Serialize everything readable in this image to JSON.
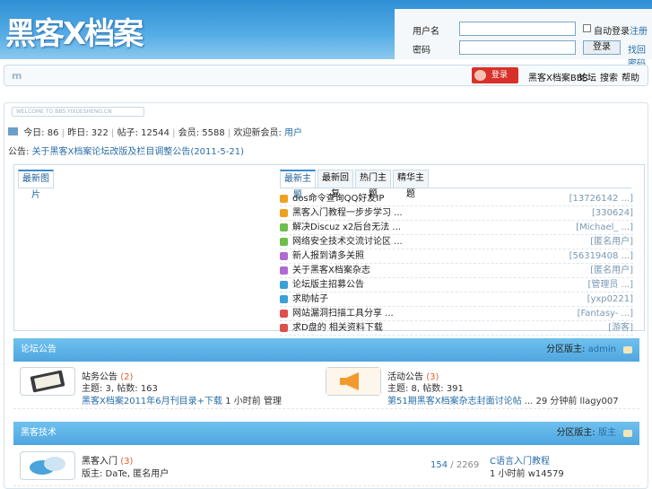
{
  "header": {
    "logo_text": "黑客X档案",
    "login": {
      "username_label": "用户名",
      "password_label": "密码",
      "remember_label": "自动登录",
      "register_link": "注册",
      "login_button": "登录",
      "forgot_link": "找回密码"
    }
  },
  "nav": {
    "logo": "m",
    "register_button": "登录",
    "items": [
      "黑客X档案BBS",
      "论坛",
      "搜索",
      "帮助"
    ]
  },
  "welcome": "WELCOME TO BBS.YIXUESHENG.CN",
  "stats": {
    "today_label": "今日:",
    "today": "86",
    "yesterday_label": "昨日:",
    "yesterday": "322",
    "posts_label": "帖子:",
    "posts": "12544",
    "members_label": "会员:",
    "members": "5588",
    "newest_label": "欢迎新会员:",
    "newest": "用户"
  },
  "notice": {
    "label": "公告:",
    "text": "关于黑客X档案论坛改版及栏目调整公告",
    "date": "(2011-5-21)"
  },
  "panel": {
    "left_tab": "最新图片",
    "tabs": [
      "最新主题",
      "最新回复",
      "热门主题",
      "精华主题"
    ],
    "topics": [
      {
        "title": "dos命令查询QQ好友IP",
        "user": "[13726142 ...]",
        "color": "#f0a020"
      },
      {
        "title": "黑客入门教程一步步学习 ...",
        "user": "[330624]",
        "color": "#f0a020"
      },
      {
        "title": "解决Discuz x2后台无法 ...",
        "user": "[Michael_ ...]",
        "color": "#6cbf4a"
      },
      {
        "title": "网络安全技术交流讨论区 ...",
        "user": "[匿名用户]",
        "color": "#6cbf4a"
      },
      {
        "title": "新人报到请多关照",
        "user": "[56319408 ...]",
        "color": "#b06ad0"
      },
      {
        "title": "关于黑客X档案杂志",
        "user": "[匿名用户]",
        "color": "#b06ad0"
      },
      {
        "title": "论坛版主招募公告",
        "user": "[管理员 ...]",
        "color": "#3aa0d8"
      },
      {
        "title": "求助帖子",
        "user": "[yxp0221]",
        "color": "#3aa0d8"
      },
      {
        "title": "网站漏洞扫描工具分享 ...",
        "user": "[Fantasy- ...]",
        "color": "#e0504a"
      },
      {
        "title": "求D盘的 相关资料下载",
        "user": "[游客]",
        "color": "#e0504a"
      }
    ]
  },
  "section1": {
    "title": "论坛公告",
    "mod_label": "分区版主:",
    "mod": "admin",
    "forums": [
      {
        "name": "站务公告",
        "count": "(2)",
        "stats": "主题: 3, 帖数: 163",
        "last": "黑客X档案2011年6月刊目录+下载",
        "last_meta": "1 小时前 管理"
      },
      {
        "name": "活动公告",
        "count": "(3)",
        "stats": "主题: 8, 帖数: 391",
        "last": "第51期黑客X档案杂志封面讨论帖",
        "last_meta": "... 29 分钟前 llagy007"
      }
    ]
  },
  "section2": {
    "title": "黑客技术",
    "mod_label": "分区版主:",
    "mod": "版主",
    "forum": {
      "name": "黑客入门",
      "count": "(3)",
      "mods": "版主: DaTe, 匿名用户",
      "threads": "154",
      "posts": "/ 2269",
      "last": "C语言入门教程",
      "last_meta": "1 小时前 w14579"
    }
  }
}
